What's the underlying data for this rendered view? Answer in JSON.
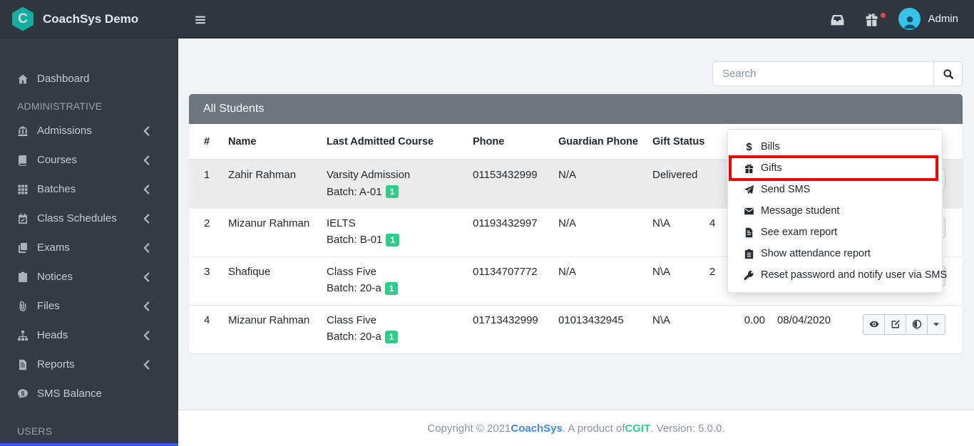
{
  "colors": {
    "navbar_bg": "#30363e",
    "sidebar_bg": "#353b44",
    "content_bg": "#f1f3f6",
    "card_header_bg": "#6e757d",
    "row_highlight": "#ececec",
    "badge_green": "#2dce89",
    "link_blue": "#3b8beb",
    "cgit_green": "#2ecc8e",
    "annotation_red": "#f20000",
    "notification_red": "#e04b4b",
    "avatar_cyan": "#35c3e8",
    "active_strip_blue": "#2c61e8"
  },
  "navbar": {
    "brand": "CoachSys Demo",
    "admin_label": "Admin",
    "icons": [
      "inbox-icon",
      "gift-icon",
      "avatar-person-icon"
    ]
  },
  "sidebar": {
    "items": [
      {
        "type": "item",
        "label": "Dashboard",
        "icon": "home-icon",
        "chevron": false
      },
      {
        "type": "header",
        "label": "ADMINISTRATIVE"
      },
      {
        "type": "item",
        "label": "Admissions",
        "icon": "school-icon",
        "chevron": true
      },
      {
        "type": "item",
        "label": "Courses",
        "icon": "book-icon",
        "chevron": true
      },
      {
        "type": "item",
        "label": "Batches",
        "icon": "grid-icon",
        "chevron": true
      },
      {
        "type": "item",
        "label": "Class Schedules",
        "icon": "calendar-icon",
        "chevron": true
      },
      {
        "type": "item",
        "label": "Exams",
        "icon": "copy-icon",
        "chevron": true
      },
      {
        "type": "item",
        "label": "Notices",
        "icon": "clipboard-icon",
        "chevron": true
      },
      {
        "type": "item",
        "label": "Files",
        "icon": "paperclip-icon",
        "chevron": true
      },
      {
        "type": "item",
        "label": "Heads",
        "icon": "sitemap-icon",
        "chevron": true
      },
      {
        "type": "item",
        "label": "Reports",
        "icon": "file-report-icon",
        "chevron": true
      },
      {
        "type": "item",
        "label": "SMS Balance",
        "icon": "comment-dollar-icon",
        "chevron": false
      },
      {
        "type": "header",
        "label": "USERS"
      }
    ]
  },
  "search": {
    "placeholder": "Search"
  },
  "card": {
    "title": "All Students"
  },
  "table": {
    "headers": [
      "#",
      "Name",
      "Last Admitted Course",
      "Phone",
      "Guardian Phone",
      "Gift Status",
      "",
      "",
      ""
    ],
    "rows": [
      {
        "num": "1",
        "name": "Zahir Rahman",
        "course": "Varsity Admission",
        "batch_label": "Batch: A-01",
        "batch_count": "1",
        "phone": "01153432999",
        "guardian_phone": "N/A",
        "gift_status": "Delivered",
        "due": "",
        "admitted": "",
        "highlighted": true,
        "due_partial": false
      },
      {
        "num": "2",
        "name": "Mizanur Rahman",
        "course": "IELTS",
        "batch_label": "Batch: B-01",
        "batch_count": "1",
        "phone": "01193432997",
        "guardian_phone": "N/A",
        "gift_status": "N\\A",
        "due": "4",
        "admitted": "",
        "highlighted": false,
        "due_partial": true
      },
      {
        "num": "3",
        "name": "Shafique",
        "course": "Class Five",
        "batch_label": "Batch: 20-a",
        "batch_count": "1",
        "phone": "01134707772",
        "guardian_phone": "N/A",
        "gift_status": "N\\A",
        "due": "2",
        "admitted": "",
        "highlighted": false,
        "due_partial": true
      },
      {
        "num": "4",
        "name": "Mizanur Rahman",
        "course": "Class Five",
        "batch_label": "Batch: 20-a",
        "batch_count": "1",
        "phone": "01713432999",
        "guardian_phone": "01013432945",
        "gift_status": "N\\A",
        "due": "0.00",
        "admitted": "08/04/2020",
        "highlighted": false,
        "due_partial": false
      }
    ],
    "row_action_icons": [
      "eye-icon",
      "edit-icon",
      "adjust-toggle-icon",
      "caret-down-icon"
    ]
  },
  "context_menu": {
    "items": [
      {
        "label": "Bills",
        "icon": "dollar-icon",
        "highlighted": false
      },
      {
        "label": "Gifts",
        "icon": "gift-icon",
        "highlighted": true
      },
      {
        "label": "Send SMS",
        "icon": "send-icon",
        "highlighted": false
      },
      {
        "label": "Message student",
        "icon": "envelope-icon",
        "highlighted": false
      },
      {
        "label": "See exam report",
        "icon": "exam-report-icon",
        "highlighted": false
      },
      {
        "label": "Show attendance report",
        "icon": "attendance-report-icon",
        "highlighted": false
      },
      {
        "label": "Reset password and notify user via SMS",
        "icon": "key-icon",
        "highlighted": false
      }
    ]
  },
  "footer": {
    "prefix": "Copyright © 2021 ",
    "brand_link": "CoachSys",
    "middle": ". A product of ",
    "cgit_link": "CGIT",
    "suffix": ". Version: 5.0.0."
  }
}
